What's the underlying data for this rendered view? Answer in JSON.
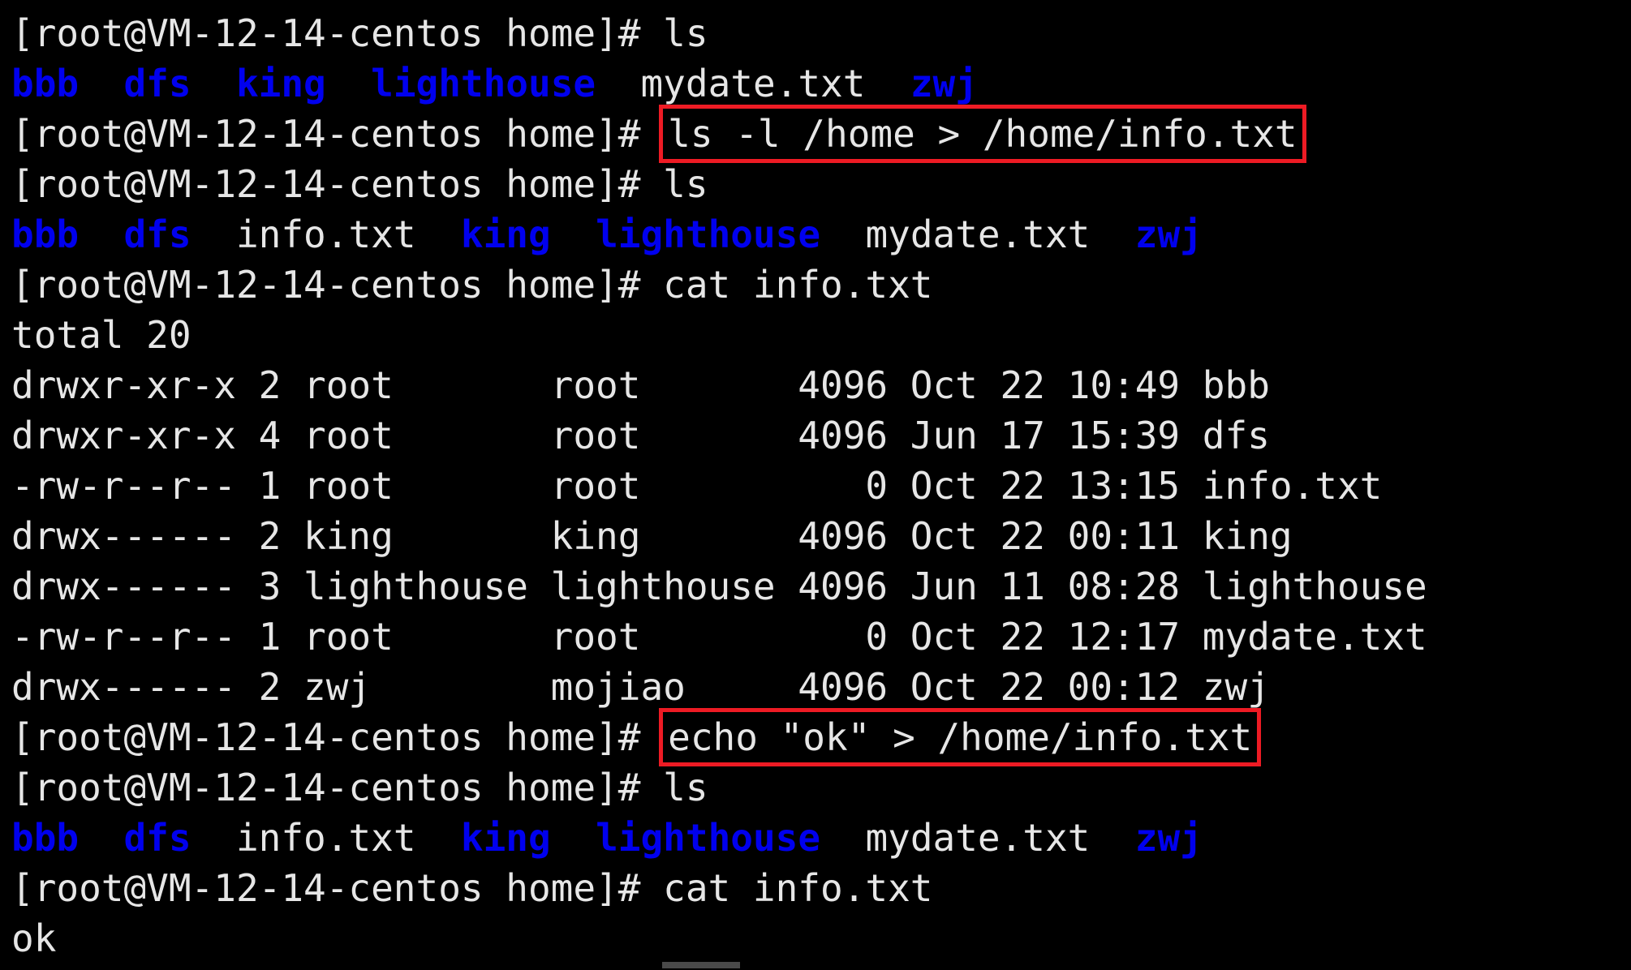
{
  "terminal": {
    "prompt": "[root@VM-12-14-centos home]# ",
    "colors": {
      "background": "#000000",
      "foreground": "#e6e6e6",
      "directory_blue": "#0000ee",
      "highlight_red": "#ee1b24",
      "cursor_gray": "#4a4a4a"
    },
    "lines": [
      {
        "id": "line-1",
        "type": "prompt",
        "prompt": "[root@VM-12-14-centos home]# ",
        "command": "ls",
        "highlighted": false
      },
      {
        "id": "line-2",
        "type": "ls-output",
        "entries": [
          {
            "name": "bbb",
            "kind": "dir"
          },
          {
            "name": "dfs",
            "kind": "dir"
          },
          {
            "name": "king",
            "kind": "dir"
          },
          {
            "name": "lighthouse",
            "kind": "dir"
          },
          {
            "name": "mydate.txt",
            "kind": "file"
          },
          {
            "name": "zwj",
            "kind": "dir"
          }
        ],
        "text": "bbb  dfs  king  lighthouse  mydate.txt  zwj"
      },
      {
        "id": "line-3",
        "type": "prompt",
        "prompt": "[root@VM-12-14-centos home]# ",
        "command": "ls -l /home > /home/info.txt",
        "highlighted": true
      },
      {
        "id": "line-4",
        "type": "prompt",
        "prompt": "[root@VM-12-14-centos home]# ",
        "command": "ls",
        "highlighted": false
      },
      {
        "id": "line-5",
        "type": "ls-output",
        "entries": [
          {
            "name": "bbb",
            "kind": "dir"
          },
          {
            "name": "dfs",
            "kind": "dir"
          },
          {
            "name": "info.txt",
            "kind": "file"
          },
          {
            "name": "king",
            "kind": "dir"
          },
          {
            "name": "lighthouse",
            "kind": "dir"
          },
          {
            "name": "mydate.txt",
            "kind": "file"
          },
          {
            "name": "zwj",
            "kind": "dir"
          }
        ],
        "text": "bbb  dfs  info.txt  king  lighthouse  mydate.txt  zwj"
      },
      {
        "id": "line-6",
        "type": "prompt",
        "prompt": "[root@VM-12-14-centos home]# ",
        "command": "cat info.txt",
        "highlighted": false
      },
      {
        "id": "line-7",
        "type": "output",
        "text": "total 20"
      },
      {
        "id": "line-8",
        "type": "output",
        "text": "drwxr-xr-x 2 root       root       4096 Oct 22 10:49 bbb"
      },
      {
        "id": "line-9",
        "type": "output",
        "text": "drwxr-xr-x 4 root       root       4096 Jun 17 15:39 dfs"
      },
      {
        "id": "line-10",
        "type": "output",
        "text": "-rw-r--r-- 1 root       root          0 Oct 22 13:15 info.txt"
      },
      {
        "id": "line-11",
        "type": "output",
        "text": "drwx------ 2 king       king       4096 Oct 22 00:11 king"
      },
      {
        "id": "line-12",
        "type": "output",
        "text": "drwx------ 3 lighthouse lighthouse 4096 Jun 11 08:28 lighthouse"
      },
      {
        "id": "line-13",
        "type": "output",
        "text": "-rw-r--r-- 1 root       root          0 Oct 22 12:17 mydate.txt"
      },
      {
        "id": "line-14",
        "type": "output",
        "text": "drwx------ 2 zwj        mojiao     4096 Oct 22 00:12 zwj"
      },
      {
        "id": "line-15",
        "type": "prompt",
        "prompt": "[root@VM-12-14-centos home]# ",
        "command": "echo \"ok\" > /home/info.txt",
        "highlighted": true
      },
      {
        "id": "line-16",
        "type": "prompt",
        "prompt": "[root@VM-12-14-centos home]# ",
        "command": "ls",
        "highlighted": false
      },
      {
        "id": "line-17",
        "type": "ls-output",
        "entries": [
          {
            "name": "bbb",
            "kind": "dir"
          },
          {
            "name": "dfs",
            "kind": "dir"
          },
          {
            "name": "info.txt",
            "kind": "file"
          },
          {
            "name": "king",
            "kind": "dir"
          },
          {
            "name": "lighthouse",
            "kind": "dir"
          },
          {
            "name": "mydate.txt",
            "kind": "file"
          },
          {
            "name": "zwj",
            "kind": "dir"
          }
        ],
        "text": "bbb  dfs  info.txt  king  lighthouse  mydate.txt  zwj"
      },
      {
        "id": "line-18",
        "type": "prompt",
        "prompt": "[root@VM-12-14-centos home]# ",
        "command": "cat info.txt",
        "highlighted": false
      },
      {
        "id": "line-19",
        "type": "output",
        "text": "ok"
      }
    ],
    "file_listing_table": {
      "columns": [
        "permissions",
        "links",
        "owner",
        "group",
        "size",
        "month",
        "day",
        "time",
        "name"
      ],
      "total": "total 20",
      "rows": [
        {
          "permissions": "drwxr-xr-x",
          "links": "2",
          "owner": "root",
          "group": "root",
          "size": "4096",
          "month": "Oct",
          "day": "22",
          "time": "10:49",
          "name": "bbb"
        },
        {
          "permissions": "drwxr-xr-x",
          "links": "4",
          "owner": "root",
          "group": "root",
          "size": "4096",
          "month": "Jun",
          "day": "17",
          "time": "15:39",
          "name": "dfs"
        },
        {
          "permissions": "-rw-r--r--",
          "links": "1",
          "owner": "root",
          "group": "root",
          "size": "0",
          "month": "Oct",
          "day": "22",
          "time": "13:15",
          "name": "info.txt"
        },
        {
          "permissions": "drwx------",
          "links": "2",
          "owner": "king",
          "group": "king",
          "size": "4096",
          "month": "Oct",
          "day": "22",
          "time": "00:11",
          "name": "king"
        },
        {
          "permissions": "drwx------",
          "links": "3",
          "owner": "lighthouse",
          "group": "lighthouse",
          "size": "4096",
          "month": "Jun",
          "day": "11",
          "time": "08:28",
          "name": "lighthouse"
        },
        {
          "permissions": "-rw-r--r--",
          "links": "1",
          "owner": "root",
          "group": "root",
          "size": "0",
          "month": "Oct",
          "day": "22",
          "time": "12:17",
          "name": "mydate.txt"
        },
        {
          "permissions": "drwx------",
          "links": "2",
          "owner": "zwj",
          "group": "mojiao",
          "size": "4096",
          "month": "Oct",
          "day": "22",
          "time": "00:12",
          "name": "zwj"
        }
      ]
    }
  }
}
